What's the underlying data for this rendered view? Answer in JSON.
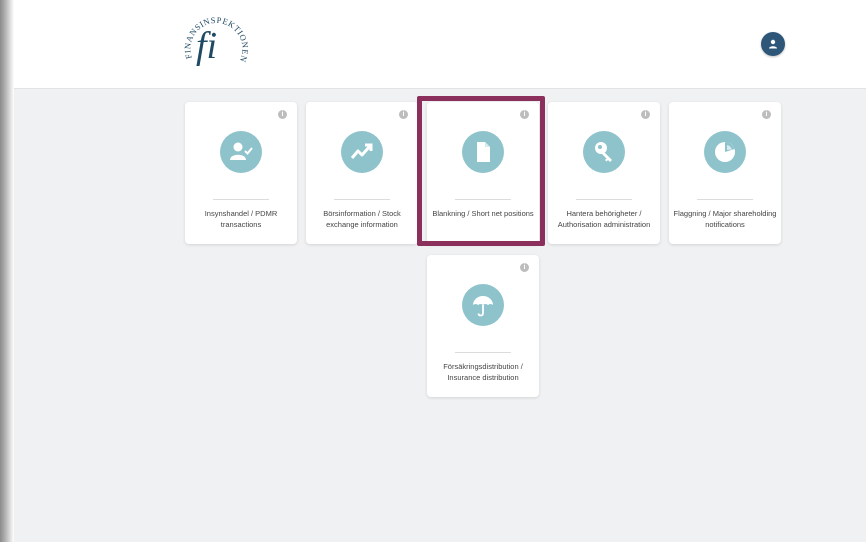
{
  "header": {
    "logo_arc_text": "FINANSINSPEKTIONEN",
    "logo_mark": "fi"
  },
  "info_symbol": "i",
  "cards": [
    {
      "label": "Insynshandel / PDMR transactions",
      "icon": "person-check-icon"
    },
    {
      "label": "Börsinformation / Stock exchange information",
      "icon": "trend-up-icon"
    },
    {
      "label": "Blankning / Short net positions",
      "icon": "document-icon"
    },
    {
      "label": "Hantera behörigheter / Authorisation administration",
      "icon": "key-icon"
    },
    {
      "label": "Flaggning / Major shareholding notifications",
      "icon": "pie-chart-icon"
    },
    {
      "label": "Försäkringsdistribution / Insurance distribution",
      "icon": "umbrella-icon"
    }
  ],
  "colors": {
    "icon_bg": "#8ec3cc",
    "highlight": "#8b2f5c",
    "avatar": "#2e5679",
    "page_bg": "#f0f1f3"
  }
}
